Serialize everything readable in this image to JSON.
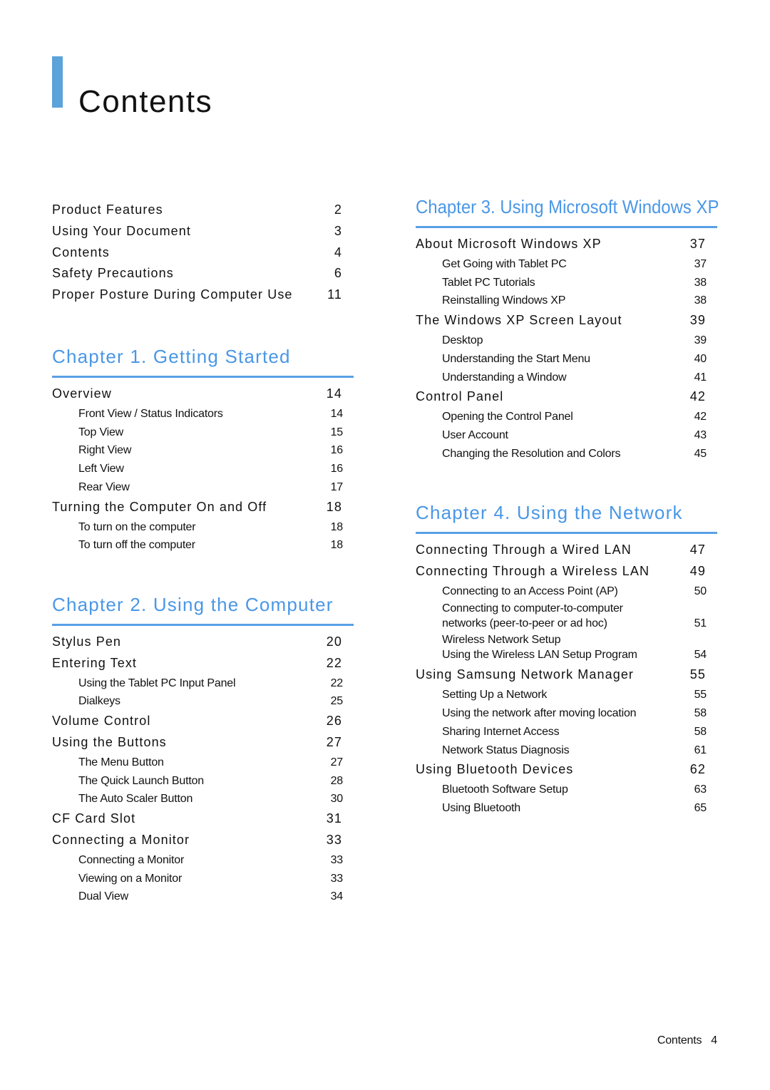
{
  "page": {
    "title": "Contents",
    "accent_color": "#5ba3d9",
    "chapter_color": "#4a97e6"
  },
  "intro": [
    {
      "label": "Product Features",
      "page": "2"
    },
    {
      "label": "Using Your Document",
      "page": "3"
    },
    {
      "label": "Contents",
      "page": "4"
    },
    {
      "label": "Safety Precautions",
      "page": "6"
    },
    {
      "label": "Proper Posture During Computer Use",
      "page": "11"
    }
  ],
  "chapters": [
    {
      "title": "Chapter 1. Getting Started",
      "entries": [
        {
          "label": "Overview",
          "page": "14",
          "level": 1
        },
        {
          "label": "Front View / Status Indicators",
          "page": "14",
          "level": 2
        },
        {
          "label": "Top View",
          "page": "15",
          "level": 2
        },
        {
          "label": "Right View",
          "page": "16",
          "level": 2
        },
        {
          "label": "Left View",
          "page": "16",
          "level": 2
        },
        {
          "label": "Rear View",
          "page": "17",
          "level": 2
        },
        {
          "label": "Turning the Computer On and Off",
          "page": "18",
          "level": 1
        },
        {
          "label": "To turn on the computer",
          "page": "18",
          "level": 2
        },
        {
          "label": "To turn off the computer",
          "page": "18",
          "level": 2
        }
      ]
    },
    {
      "title": "Chapter 2. Using the Computer",
      "entries": [
        {
          "label": "Stylus Pen",
          "page": "20",
          "level": 1
        },
        {
          "label": "Entering Text",
          "page": "22",
          "level": 1
        },
        {
          "label": "Using the Tablet PC Input Panel",
          "page": "22",
          "level": 2
        },
        {
          "label": "Dialkeys",
          "page": "25",
          "level": 2
        },
        {
          "label": "Volume Control",
          "page": "26",
          "level": 1
        },
        {
          "label": "Using the Buttons",
          "page": "27",
          "level": 1
        },
        {
          "label": "The Menu Button",
          "page": "27",
          "level": 2
        },
        {
          "label": "The Quick Launch Button",
          "page": "28",
          "level": 2
        },
        {
          "label": "The Auto Scaler Button",
          "page": "30",
          "level": 2
        },
        {
          "label": "CF Card Slot",
          "page": "31",
          "level": 1
        },
        {
          "label": "Connecting a Monitor",
          "page": "33",
          "level": 1
        },
        {
          "label": "Connecting a Monitor",
          "page": "33",
          "level": 2
        },
        {
          "label": "Viewing on a Monitor",
          "page": "33",
          "level": 2
        },
        {
          "label": "Dual View",
          "page": "34",
          "level": 2
        }
      ]
    },
    {
      "title": "Chapter 3. Using Microsoft Windows XP",
      "entries": [
        {
          "label": "About Microsoft Windows XP",
          "page": "37",
          "level": 1
        },
        {
          "label": "Get Going with Tablet PC",
          "page": "37",
          "level": 2
        },
        {
          "label": "Tablet PC Tutorials",
          "page": "38",
          "level": 2
        },
        {
          "label": "Reinstalling Windows XP",
          "page": "38",
          "level": 2
        },
        {
          "label": "The Windows XP Screen Layout",
          "page": "39",
          "level": 1
        },
        {
          "label": "Desktop",
          "page": "39",
          "level": 2
        },
        {
          "label": "Understanding the Start Menu",
          "page": "40",
          "level": 2
        },
        {
          "label": "Understanding a Window",
          "page": "41",
          "level": 2
        },
        {
          "label": "Control Panel",
          "page": "42",
          "level": 1
        },
        {
          "label": "Opening the Control Panel",
          "page": "42",
          "level": 2
        },
        {
          "label": "User Account",
          "page": "43",
          "level": 2
        },
        {
          "label": "Changing the Resolution and Colors",
          "page": "45",
          "level": 2
        }
      ]
    },
    {
      "title": "Chapter 4. Using the Network",
      "entries": [
        {
          "label": "Connecting Through a Wired LAN",
          "page": "47",
          "level": 1
        },
        {
          "label": "Connecting Through a Wireless LAN",
          "page": "49",
          "level": 1
        },
        {
          "label": "Connecting to an Access Point (AP)",
          "page": "50",
          "level": 2
        },
        {
          "label": "Connecting to computer-to-computer networks (peer-to-peer or ad hoc)",
          "page": "51",
          "level": 2,
          "line1": "Connecting to computer-to-computer",
          "line2": "networks (peer-to-peer or ad hoc)"
        },
        {
          "label": "Wireless Network Setup Using the Wireless LAN Setup Program",
          "page": "54",
          "level": 2,
          "line1": "Wireless Network Setup",
          "line2": "Using the Wireless LAN Setup Program"
        },
        {
          "label": "Using Samsung Network Manager",
          "page": "55",
          "level": 1
        },
        {
          "label": "Setting Up a Network",
          "page": "55",
          "level": 2
        },
        {
          "label": "Using the network after moving location",
          "page": "58",
          "level": 2
        },
        {
          "label": "Sharing Internet Access",
          "page": "58",
          "level": 2
        },
        {
          "label": "Network Status Diagnosis",
          "page": "61",
          "level": 2
        },
        {
          "label": "Using Bluetooth Devices",
          "page": "62",
          "level": 1
        },
        {
          "label": "Bluetooth Software Setup",
          "page": "63",
          "level": 2
        },
        {
          "label": "Using Bluetooth",
          "page": "65",
          "level": 2
        }
      ]
    }
  ],
  "footer": {
    "section": "Contents",
    "page_number": "4"
  }
}
